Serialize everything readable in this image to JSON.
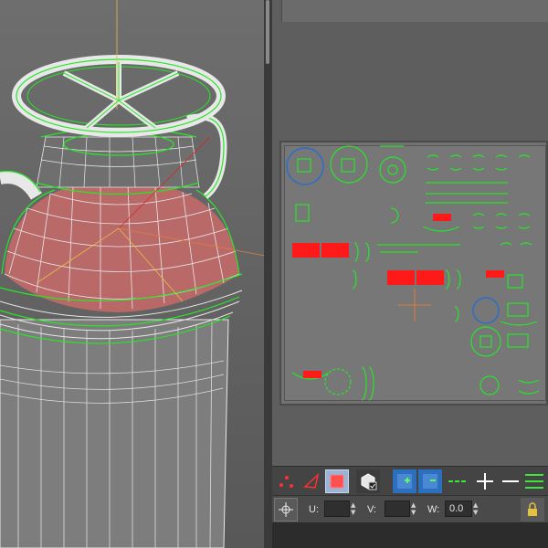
{
  "statusbar": {
    "u_label": "U:",
    "v_label": "V:",
    "w_label": "W:",
    "u_value": "",
    "v_value": "",
    "w_value": "0.0"
  },
  "icons": {
    "vertex_mode": "vertex-select-icon",
    "edge_mode": "edge-select-icon",
    "face_mode": "face-select-icon",
    "element_mode": "element-select-icon",
    "grow": "grow-selection-icon",
    "shrink": "shrink-selection-icon",
    "loop": "loop-select-icon",
    "ring": "ring-select-icon",
    "freeform": "freeform-icon",
    "lock": "lock-icon",
    "pan": "pan-icon"
  },
  "colors": {
    "wire_white": "#e8e8e8",
    "wire_green": "#27e627",
    "face_red": "#d44848",
    "select_red": "#ff1a1a",
    "uv_blue": "#2a6ec8",
    "gizmo_orange": "#e07a3a"
  }
}
